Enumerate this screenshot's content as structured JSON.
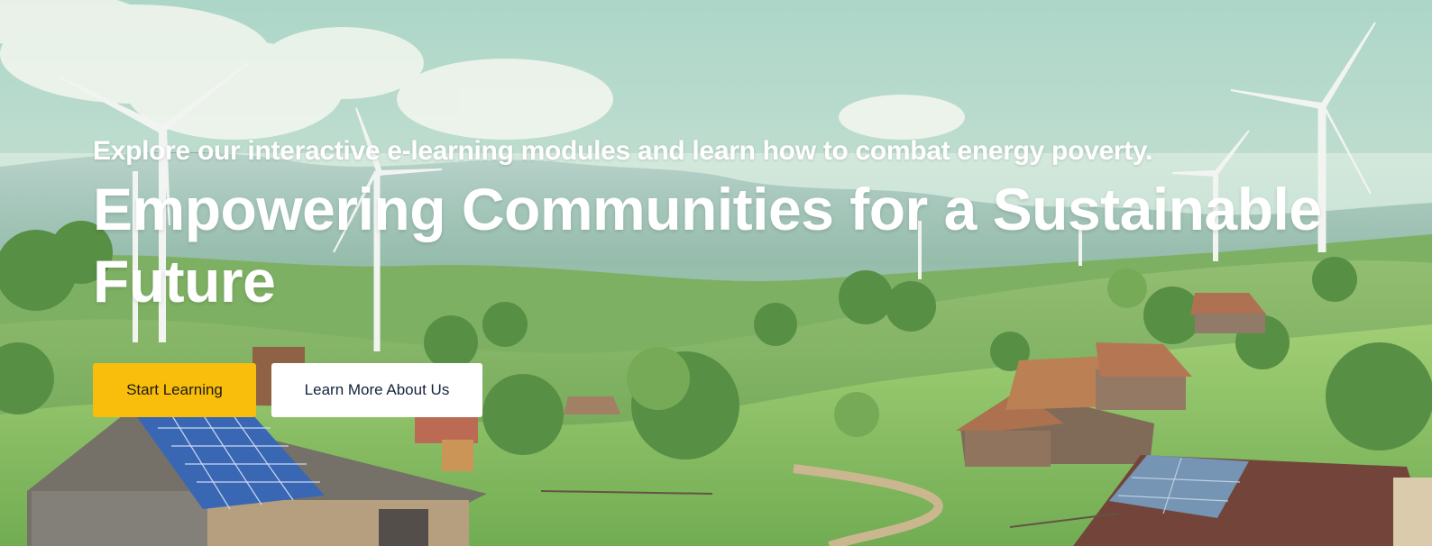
{
  "hero": {
    "eyebrow": "Explore our interactive e-learning modules and learn how to combat energy poverty.",
    "title": "Empowering Communities for a Sustainable Future",
    "primary_button": "Start Learning",
    "secondary_button": "Learn More About Us"
  },
  "colors": {
    "primary_button_bg": "#f9bd0b",
    "secondary_button_bg": "#ffffff",
    "heading_text": "#ffffff"
  }
}
